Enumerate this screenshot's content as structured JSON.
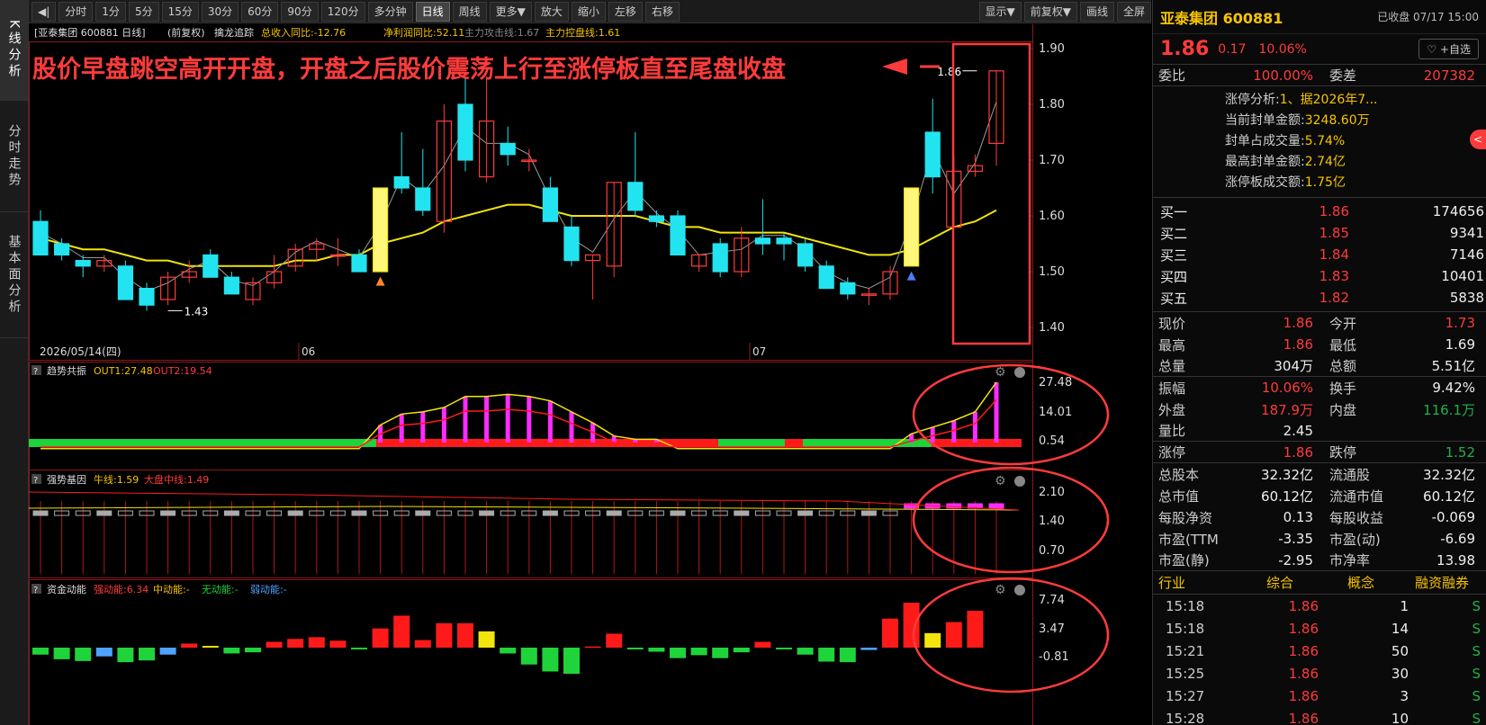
{
  "leftnav": [
    {
      "label": "K线分析",
      "active": true
    },
    {
      "label": "分时走势",
      "active": false
    },
    {
      "label": "基本面分析",
      "active": false
    }
  ],
  "toolbar": {
    "back": "◀|",
    "buttons": [
      "分时",
      "1分",
      "5分",
      "15分",
      "30分",
      "60分",
      "90分",
      "120分",
      "多分钟",
      "日线",
      "周线",
      "更多▼",
      "放大",
      "缩小",
      "左移",
      "右移"
    ],
    "active": "日线",
    "right_buttons": [
      "显示▼",
      "前复权▼",
      "画线",
      "全屏"
    ]
  },
  "main_header": {
    "stock": "[亚泰集团 600881 日线]",
    "adjust": "(前复权)",
    "indicator": "擒龙追踪",
    "rev": "总收入同比:-12.76",
    "profit": "净利润同比:52.11",
    "attack": "主力攻击线:1.67",
    "control": "主力控盘线:1.61"
  },
  "annotation": "股价早盘跳空高开开盘，开盘之后股价震荡上行至涨停板直至尾盘收盘",
  "price_axis": [
    "1.90",
    "1.80",
    "1.70",
    "1.60",
    "1.50",
    "1.40"
  ],
  "low_label": "1.43",
  "high_label": "1.86",
  "dates": [
    "2026/05/14(四)",
    "06",
    "07"
  ],
  "panel1": {
    "q": "?",
    "name": "趋势共振",
    "o1": "OUT1:27.48",
    "o2": "OUT2:19.54",
    "ticks": [
      "27.48",
      "14.01",
      "0.54"
    ]
  },
  "panel2": {
    "q": "?",
    "name": "强势基因",
    "o1": "牛线:1.59",
    "o2": "大盘中线:1.49",
    "ticks": [
      "2.10",
      "1.40",
      "0.70"
    ]
  },
  "panel3": {
    "q": "?",
    "name": "资金动能",
    "o1": "强动能:6.34",
    "o2": "中动能:-",
    "o3": "无动能:-",
    "o4": "弱动能:-",
    "ticks": [
      "7.74",
      "3.47",
      "-0.81"
    ]
  },
  "candles": [
    {
      "o": 1.59,
      "h": 1.61,
      "l": 1.53,
      "c": 1.53
    },
    {
      "o": 1.55,
      "h": 1.56,
      "l": 1.52,
      "c": 1.53
    },
    {
      "o": 1.52,
      "h": 1.53,
      "l": 1.49,
      "c": 1.51
    },
    {
      "o": 1.51,
      "h": 1.53,
      "l": 1.5,
      "c": 1.52
    },
    {
      "o": 1.51,
      "h": 1.52,
      "l": 1.45,
      "c": 1.45
    },
    {
      "o": 1.47,
      "h": 1.48,
      "l": 1.43,
      "c": 1.44
    },
    {
      "o": 1.45,
      "h": 1.5,
      "l": 1.44,
      "c": 1.49
    },
    {
      "o": 1.49,
      "h": 1.52,
      "l": 1.48,
      "c": 1.5
    },
    {
      "o": 1.53,
      "h": 1.54,
      "l": 1.49,
      "c": 1.49
    },
    {
      "o": 1.49,
      "h": 1.5,
      "l": 1.46,
      "c": 1.46
    },
    {
      "o": 1.45,
      "h": 1.49,
      "l": 1.44,
      "c": 1.48
    },
    {
      "o": 1.48,
      "h": 1.53,
      "l": 1.47,
      "c": 1.5
    },
    {
      "o": 1.51,
      "h": 1.55,
      "l": 1.5,
      "c": 1.54
    },
    {
      "o": 1.54,
      "h": 1.56,
      "l": 1.52,
      "c": 1.55
    },
    {
      "o": 1.53,
      "h": 1.56,
      "l": 1.51,
      "c": 1.53
    },
    {
      "o": 1.53,
      "h": 1.54,
      "l": 1.5,
      "c": 1.5
    },
    {
      "o": 1.5,
      "h": 1.65,
      "l": 1.5,
      "c": 1.65
    },
    {
      "o": 1.67,
      "h": 1.75,
      "l": 1.64,
      "c": 1.65
    },
    {
      "o": 1.65,
      "h": 1.72,
      "l": 1.6,
      "c": 1.61
    },
    {
      "o": 1.59,
      "h": 1.8,
      "l": 1.57,
      "c": 1.77
    },
    {
      "o": 1.8,
      "h": 1.85,
      "l": 1.68,
      "c": 1.7
    },
    {
      "o": 1.67,
      "h": 1.85,
      "l": 1.66,
      "c": 1.77
    },
    {
      "o": 1.73,
      "h": 1.76,
      "l": 1.69,
      "c": 1.71
    },
    {
      "o": 1.7,
      "h": 1.72,
      "l": 1.68,
      "c": 1.7
    },
    {
      "o": 1.65,
      "h": 1.67,
      "l": 1.59,
      "c": 1.59
    },
    {
      "o": 1.58,
      "h": 1.6,
      "l": 1.51,
      "c": 1.52
    },
    {
      "o": 1.52,
      "h": 1.53,
      "l": 1.45,
      "c": 1.53
    },
    {
      "o": 1.51,
      "h": 1.66,
      "l": 1.49,
      "c": 1.66
    },
    {
      "o": 1.66,
      "h": 1.75,
      "l": 1.6,
      "c": 1.61
    },
    {
      "o": 1.6,
      "h": 1.61,
      "l": 1.58,
      "c": 1.59
    },
    {
      "o": 1.6,
      "h": 1.61,
      "l": 1.53,
      "c": 1.53
    },
    {
      "o": 1.51,
      "h": 1.53,
      "l": 1.5,
      "c": 1.53
    },
    {
      "o": 1.55,
      "h": 1.56,
      "l": 1.49,
      "c": 1.5
    },
    {
      "o": 1.5,
      "h": 1.58,
      "l": 1.49,
      "c": 1.56
    },
    {
      "o": 1.56,
      "h": 1.63,
      "l": 1.53,
      "c": 1.55
    },
    {
      "o": 1.56,
      "h": 1.57,
      "l": 1.52,
      "c": 1.55
    },
    {
      "o": 1.55,
      "h": 1.56,
      "l": 1.5,
      "c": 1.51
    },
    {
      "o": 1.51,
      "h": 1.52,
      "l": 1.47,
      "c": 1.47
    },
    {
      "o": 1.48,
      "h": 1.49,
      "l": 1.45,
      "c": 1.46
    },
    {
      "o": 1.46,
      "h": 1.47,
      "l": 1.44,
      "c": 1.46
    },
    {
      "o": 1.46,
      "h": 1.51,
      "l": 1.45,
      "c": 1.5
    },
    {
      "o": 1.51,
      "h": 1.65,
      "l": 1.51,
      "c": 1.65
    },
    {
      "o": 1.75,
      "h": 1.81,
      "l": 1.64,
      "c": 1.67
    },
    {
      "o": 1.58,
      "h": 1.71,
      "l": 1.58,
      "c": 1.68
    },
    {
      "o": 1.68,
      "h": 1.71,
      "l": 1.67,
      "c": 1.69
    },
    {
      "o": 1.73,
      "h": 1.86,
      "l": 1.69,
      "c": 1.86
    }
  ],
  "ma_yellow": [
    1.56,
    1.55,
    1.54,
    1.54,
    1.53,
    1.52,
    1.52,
    1.51,
    1.51,
    1.51,
    1.51,
    1.51,
    1.52,
    1.52,
    1.53,
    1.53,
    1.55,
    1.56,
    1.57,
    1.59,
    1.6,
    1.61,
    1.62,
    1.62,
    1.61,
    1.6,
    1.6,
    1.6,
    1.6,
    1.59,
    1.58,
    1.58,
    1.57,
    1.57,
    1.57,
    1.57,
    1.56,
    1.55,
    1.54,
    1.53,
    1.53,
    1.54,
    1.56,
    1.58,
    1.59,
    1.61
  ],
  "panel1_bars": [
    0.5,
    0.5,
    0.5,
    0.5,
    0.5,
    0.5,
    0.5,
    0.5,
    0.5,
    0.5,
    0.5,
    0.5,
    0.5,
    0.5,
    0.5,
    0.5,
    8,
    13,
    14,
    16,
    21,
    21,
    22,
    21,
    19,
    14,
    9,
    3,
    1.5,
    1.5,
    0.5,
    0.5,
    0.5,
    0.5,
    0.5,
    0.5,
    0.5,
    0.5,
    0.5,
    0.5,
    0.5,
    4,
    7,
    10,
    14,
    27.48
  ],
  "panel3_bars": [
    -1.2,
    -2.0,
    -2.3,
    -1.5,
    -2.5,
    -2.2,
    -1.2,
    0.7,
    0.3,
    -1.0,
    -0.8,
    1.0,
    1.5,
    1.8,
    1.2,
    -0.3,
    3.3,
    5.5,
    1.3,
    4.2,
    4.2,
    2.8,
    -1.0,
    -2.9,
    -4.1,
    -4.5,
    0.2,
    2.4,
    -0.3,
    -0.7,
    -1.8,
    -1.3,
    -1.8,
    -0.8,
    1.0,
    -0.3,
    -1.2,
    -2.4,
    -2.5,
    -0.4,
    5.0,
    7.74,
    2.5,
    4.4,
    6.34
  ],
  "right": {
    "title": "亚泰集团 600881",
    "status": "已收盘 07/17 15:00",
    "price": "1.86",
    "chg": "0.17",
    "pct": "10.06%",
    "fav": "♡ +自选",
    "weibi_l": "委比",
    "weibi_v": "100.00%",
    "weicha_l": "委差",
    "weicha_v": "207382",
    "limit": [
      {
        "k": "涨停分析:",
        "v": "1、据2026年7..."
      },
      {
        "k": "当前封单金额:",
        "v": "3248.60万"
      },
      {
        "k": "封单占成交量:",
        "v": "5.74%"
      },
      {
        "k": "最高封单金额:",
        "v": "2.74亿"
      },
      {
        "k": "涨停板成交额:",
        "v": "1.75亿"
      }
    ],
    "orderbook": [
      {
        "l": "买一",
        "p": "1.86",
        "q": "174656"
      },
      {
        "l": "买二",
        "p": "1.85",
        "q": "9341"
      },
      {
        "l": "买三",
        "p": "1.84",
        "q": "7146"
      },
      {
        "l": "买四",
        "p": "1.83",
        "q": "10401"
      },
      {
        "l": "买五",
        "p": "1.82",
        "q": "5838"
      }
    ],
    "stats": [
      [
        {
          "l": "现价",
          "v": "1.86",
          "c": "red"
        },
        {
          "l": "今开",
          "v": "1.73",
          "c": "red"
        }
      ],
      [
        {
          "l": "最高",
          "v": "1.86",
          "c": "red"
        },
        {
          "l": "最低",
          "v": "1.69",
          "c": "white"
        }
      ],
      [
        {
          "l": "总量",
          "v": "304万",
          "c": "white"
        },
        {
          "l": "总额",
          "v": "5.51亿",
          "c": "white"
        }
      ],
      [
        {
          "l": "振幅",
          "v": "10.06%",
          "c": "red"
        },
        {
          "l": "换手",
          "v": "9.42%",
          "c": "white"
        }
      ],
      [
        {
          "l": "外盘",
          "v": "187.9万",
          "c": "red"
        },
        {
          "l": "内盘",
          "v": "116.1万",
          "c": "green"
        }
      ],
      [
        {
          "l": "量比",
          "v": "2.45",
          "c": "white"
        },
        {
          "l": "",
          "v": "",
          "c": "white"
        }
      ],
      [
        {
          "l": "涨停",
          "v": "1.86",
          "c": "red"
        },
        {
          "l": "跌停",
          "v": "1.52",
          "c": "green"
        }
      ],
      [
        {
          "l": "总股本",
          "v": "32.32亿",
          "c": "white"
        },
        {
          "l": "流通股",
          "v": "32.32亿",
          "c": "white"
        }
      ],
      [
        {
          "l": "总市值",
          "v": "60.12亿",
          "c": "white"
        },
        {
          "l": "流通市值",
          "v": "60.12亿",
          "c": "white"
        }
      ],
      [
        {
          "l": "每股净资",
          "v": "0.13",
          "c": "white"
        },
        {
          "l": "每股收益",
          "v": "-0.069",
          "c": "white"
        }
      ],
      [
        {
          "l": "市盈(TTM",
          "v": "-3.35",
          "c": "white"
        },
        {
          "l": "市盈(动)",
          "v": "-6.69",
          "c": "white"
        }
      ],
      [
        {
          "l": "市盈(静)",
          "v": "-2.95",
          "c": "white"
        },
        {
          "l": "市净率",
          "v": "13.98",
          "c": "white"
        }
      ]
    ],
    "tick_head": [
      "行业",
      "综合",
      "概念",
      "融资融券"
    ],
    "ticks": [
      {
        "t": "15:18",
        "p": "1.86",
        "v": "1",
        "s": "S"
      },
      {
        "t": "15:18",
        "p": "1.86",
        "v": "14",
        "s": "S"
      },
      {
        "t": "15:21",
        "p": "1.86",
        "v": "50",
        "s": "S"
      },
      {
        "t": "15:25",
        "p": "1.86",
        "v": "30",
        "s": "S"
      },
      {
        "t": "15:27",
        "p": "1.86",
        "v": "3",
        "s": "S"
      },
      {
        "t": "15:28",
        "p": "1.86",
        "v": "10",
        "s": "S"
      }
    ]
  }
}
